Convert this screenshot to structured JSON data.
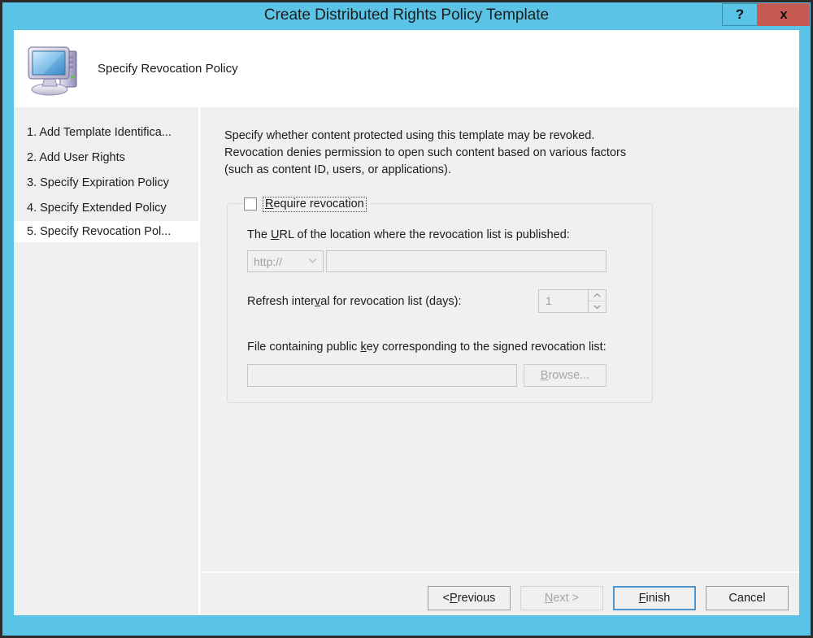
{
  "window": {
    "title": "Create Distributed Rights Policy Template",
    "help_label": "?",
    "close_label": "x",
    "accent_titlebar": "#5BC3E5",
    "accent_close": "#C75B54",
    "accent_default_button": "#4B97D1"
  },
  "header": {
    "icon": "computer-icon",
    "title": "Specify Revocation Policy"
  },
  "sidebar": {
    "items": [
      {
        "label": "1. Add Template Identifica...",
        "selected": false
      },
      {
        "label": "2. Add User Rights",
        "selected": false
      },
      {
        "label": "3. Specify Expiration Policy",
        "selected": false
      },
      {
        "label": "4. Specify Extended Policy",
        "selected": false
      },
      {
        "label": "5. Specify Revocation Pol...",
        "selected": true
      }
    ]
  },
  "content": {
    "description": "Specify whether content protected using this template may be revoked. Revocation denies permission to open such content based on various factors (such as content ID, users, or applications).",
    "groupbox": {
      "checkbox": {
        "label_before": "R",
        "label_after": "equire revocation",
        "full_label": "Require revocation",
        "checked": false,
        "focused": true
      },
      "url_label_parts": {
        "p1": "The ",
        "accel": "U",
        "p2": "RL of the location where the revocation list is published:"
      },
      "url_scheme_value": "http://",
      "url_value": "",
      "refresh_label_parts": {
        "p1": "Refresh inter",
        "accel": "v",
        "p2": "al for revocation list (days):"
      },
      "refresh_value": "1",
      "file_label_parts": {
        "p1": "File containing public ",
        "accel": "k",
        "p2": "ey corresponding to the signed revocation list:"
      },
      "file_value": "",
      "browse_label_parts": {
        "accel": "B",
        "rest": "rowse..."
      },
      "browse_label": "Browse...",
      "enabled": false
    }
  },
  "footer": {
    "buttons": [
      {
        "name": "previous",
        "prefix": "< ",
        "accel": "P",
        "rest": "revious",
        "label": "< Previous",
        "state": "enabled"
      },
      {
        "name": "next",
        "prefix": "",
        "accel": "N",
        "rest": "ext >",
        "label": "Next >",
        "state": "disabled"
      },
      {
        "name": "finish",
        "prefix": "",
        "accel": "F",
        "rest": "inish",
        "label": "Finish",
        "state": "default"
      },
      {
        "name": "cancel",
        "prefix": "",
        "accel": "",
        "rest": "Cancel",
        "label": "Cancel",
        "state": "enabled"
      }
    ]
  }
}
